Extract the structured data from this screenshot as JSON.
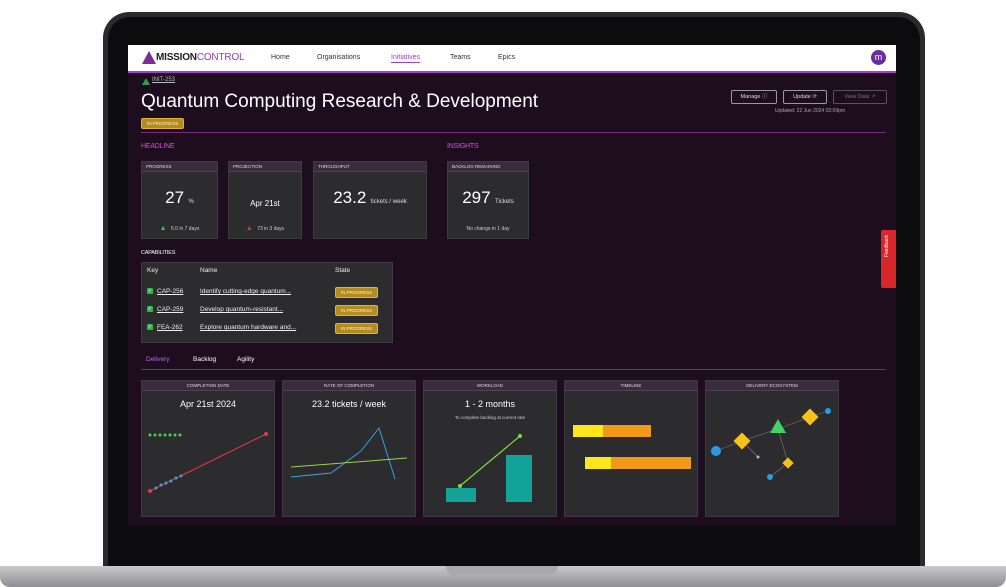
{
  "nav": {
    "logo_bold": "MISSION",
    "logo_light": "CONTROL",
    "items": [
      "Home",
      "Organisations",
      "Initiatives",
      "Teams",
      "Epics"
    ],
    "active_index": 2,
    "avatar_letter": "m"
  },
  "header": {
    "breadcrumb": "INIT-253",
    "title": "Quantum Computing Research & Development",
    "status": "IN PROGRESS",
    "buttons": {
      "manage": "Manage ⓘ",
      "update": "Update ⟳",
      "view_data": "View Data ↗"
    },
    "updated": "Updated: 22 Jun 2024 02:09pm"
  },
  "headline": {
    "label": "HEADLINE",
    "progress": {
      "title": "PROGRESS",
      "value": "27",
      "unit": "%",
      "delta": "5.0 in 7 days"
    },
    "projection": {
      "title": "PROJECTION",
      "value": "Apr 21st",
      "delta": "73 in 3 days"
    },
    "throughput": {
      "title": "THROUGHPUT",
      "value": "23.2",
      "unit": "tickets / week"
    }
  },
  "insights": {
    "label": "INSIGHTS",
    "backlog": {
      "title": "BACKLOG REMAINING",
      "value": "297",
      "unit": "Tickets",
      "note": "No change in 1 day"
    }
  },
  "capabilities": {
    "label": "CAPABILITIES",
    "headers": [
      "Key",
      "Name",
      "State"
    ],
    "rows": [
      {
        "key": "CAP-256",
        "name": "Identify cutting-edge quantum...",
        "state": "IN PROGRESS"
      },
      {
        "key": "CAP-259",
        "name": "Develop quantum-resistant...",
        "state": "IN PROGRESS"
      },
      {
        "key": "FEA-262",
        "name": "Explore quantum hardware and...",
        "state": "IN PROGRESS"
      }
    ]
  },
  "tabs": [
    "Delivery",
    "Backlog",
    "Agility"
  ],
  "panels": {
    "completion": {
      "title": "COMPLETION DATE",
      "value": "Apr 21st 2024"
    },
    "rate": {
      "title": "RATE OF COMPLETION",
      "value": "23.2 tickets / week"
    },
    "workload": {
      "title": "WORKLOAD",
      "value": "1 - 2 months",
      "note": "To complete backlog at current rate"
    },
    "timeline": {
      "title": "TIMELINE"
    },
    "ecosystem": {
      "title": "DELIVERY ECOSYSTEM"
    }
  },
  "feedback": "Feedback",
  "colors": {
    "accent": "#e04bd9",
    "nav_active": "#9b3fd3",
    "status": "#b38b1e",
    "positive": "#34c55a",
    "feedback": "#d8262d"
  }
}
